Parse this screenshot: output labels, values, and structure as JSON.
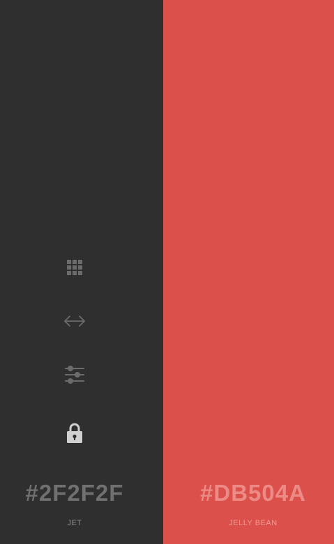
{
  "colors": {
    "left_bg": "#2F2F2F",
    "right_bg": "#DB504A",
    "left_icon": "#6b6b6b",
    "left_lock": "#d0d0d0",
    "left_hex_text": "#707070",
    "left_name_text": "#8a8a8a",
    "right_hex_text": "#ec8b86",
    "right_name_text": "#ef9a95"
  },
  "swatches": [
    {
      "hex": "#2F2F2F",
      "name": "JET"
    },
    {
      "hex": "#DB504A",
      "name": "JELLY BEAN"
    }
  ],
  "tools": [
    {
      "icon": "grid-icon"
    },
    {
      "icon": "horizontal-arrows-icon"
    },
    {
      "icon": "sliders-icon"
    },
    {
      "icon": "lock-icon"
    }
  ]
}
